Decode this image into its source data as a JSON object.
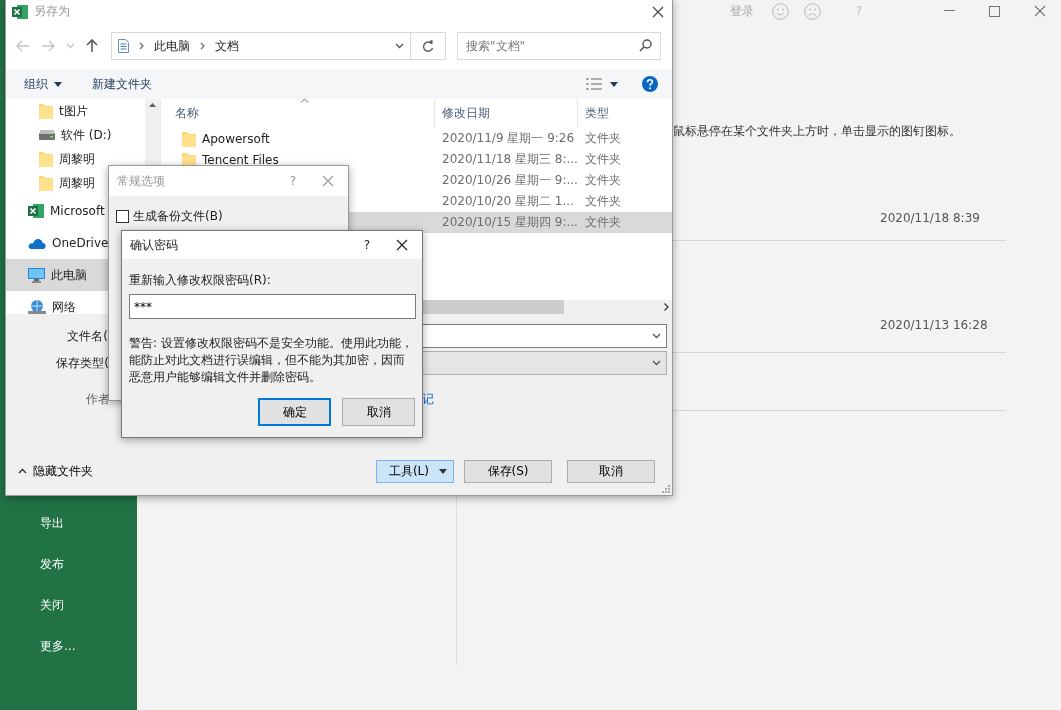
{
  "backstage": {
    "top_bar": {
      "sign_in": "登录",
      "help": "?"
    },
    "menu_items": [
      {
        "label": "导出"
      },
      {
        "label": "发布"
      },
      {
        "label": "关闭"
      },
      {
        "label": "更多..."
      }
    ],
    "pin_hint": "鼠标悬停在某个文件夹上方时，单击显示的图钉图标。",
    "recent_dates": [
      "2020/11/18 8:39",
      "2020/11/13 16:28"
    ]
  },
  "save_as_dialog": {
    "title": "另存为",
    "breadcrumb": [
      "此电脑",
      "文档"
    ],
    "search_placeholder": "搜索\"文档\"",
    "organize": "组织",
    "new_folder": "新建文件夹",
    "quick_access": [
      {
        "label": "t图片",
        "kind": "folder",
        "selected": false
      },
      {
        "label": "软件 (D:)",
        "kind": "drive",
        "selected": false
      },
      {
        "label": "周黎明",
        "kind": "folder",
        "selected": false
      },
      {
        "label": "周黎明",
        "kind": "folder",
        "selected": false
      }
    ],
    "locations": [
      {
        "label": "Microsoft",
        "kind": "excel",
        "selected": false
      },
      {
        "label": "OneDrive",
        "kind": "cloud",
        "selected": false
      },
      {
        "label": "此电脑",
        "kind": "computer",
        "selected": true
      },
      {
        "label": "网络",
        "kind": "network",
        "selected": false
      }
    ],
    "columns": [
      "名称",
      "修改日期",
      "类型"
    ],
    "rows": [
      {
        "name": "Apowersoft",
        "date": "2020/11/9 星期一 9:26",
        "type": "文件夹",
        "selected": false
      },
      {
        "name": "Tencent Files",
        "date": "2020/11/18 星期三 8:...",
        "type": "文件夹",
        "selected": false
      },
      {
        "date": "2020/10/26 星期一 9:...",
        "type": "文件夹",
        "selected": false
      },
      {
        "date": "2020/10/20 星期二 1...",
        "type": "文件夹",
        "selected": false
      },
      {
        "date": "2020/10/15 星期四 9:...",
        "type": "文件夹",
        "selected": true
      }
    ],
    "file_name_label": "文件名(",
    "file_type_label": "保存类型(",
    "authors_label": "作者",
    "tags_link": "记",
    "hide_folders": "隐藏文件夹",
    "buttons": [
      {
        "label": "工具(L)",
        "kind": "split"
      },
      {
        "label": "保存(S)",
        "kind": "push"
      },
      {
        "label": "取消",
        "kind": "push"
      }
    ]
  },
  "general_options_dialog": {
    "title": "常规选项",
    "help": "?",
    "backup": {
      "label": "生成备份文件(B)",
      "checked": false
    }
  },
  "confirm_password_dialog": {
    "title": "确认密码",
    "help": "?",
    "prompt": "重新输入修改权限密码(R):",
    "password": "***",
    "warning": "警告: 设置修改权限密码不是安全功能。使用此功能，能防止对此文档进行误编辑，但不能为其加密，因而恶意用户能够编辑文件并删除密码。",
    "buttons": [
      {
        "label": "确定",
        "default": true
      },
      {
        "label": "取消",
        "default": false
      }
    ]
  }
}
